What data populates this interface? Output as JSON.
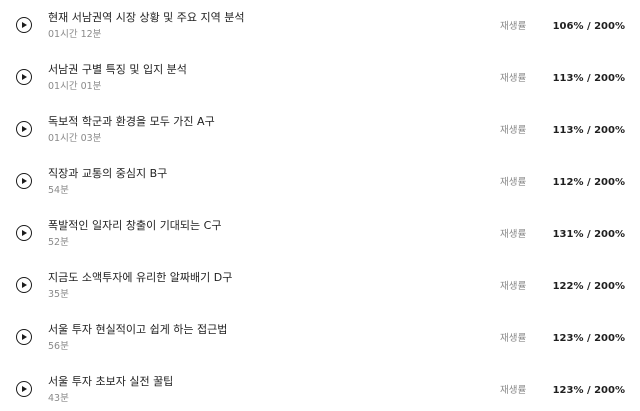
{
  "rate_label": "재생률",
  "icons": {
    "play": "play-circle-icon"
  },
  "lectures": [
    {
      "title": "현재 서남권역 시장 상황 및 주요 지역 분석",
      "duration": "01시간 12분",
      "rate": "106% / 200%"
    },
    {
      "title": "서남권 구별 특징 및 입지 분석",
      "duration": "01시간 01분",
      "rate": "113% / 200%"
    },
    {
      "title": "독보적 학군과 환경을 모두 가진 A구",
      "duration": "01시간 03분",
      "rate": "113% / 200%"
    },
    {
      "title": "직장과 교통의 중심지 B구",
      "duration": "54분",
      "rate": "112% / 200%"
    },
    {
      "title": "폭발적인 일자리 창출이 기대되는 C구",
      "duration": "52분",
      "rate": "131% / 200%"
    },
    {
      "title": "지금도 소액투자에 유리한 알짜배기 D구",
      "duration": "35분",
      "rate": "122% / 200%"
    },
    {
      "title": "서울 투자 현실적이고 쉽게 하는 접근법",
      "duration": "56분",
      "rate": "123% / 200%"
    },
    {
      "title": "서울 투자 초보자 실전 꿀팁",
      "duration": "43분",
      "rate": "123% / 200%"
    }
  ]
}
